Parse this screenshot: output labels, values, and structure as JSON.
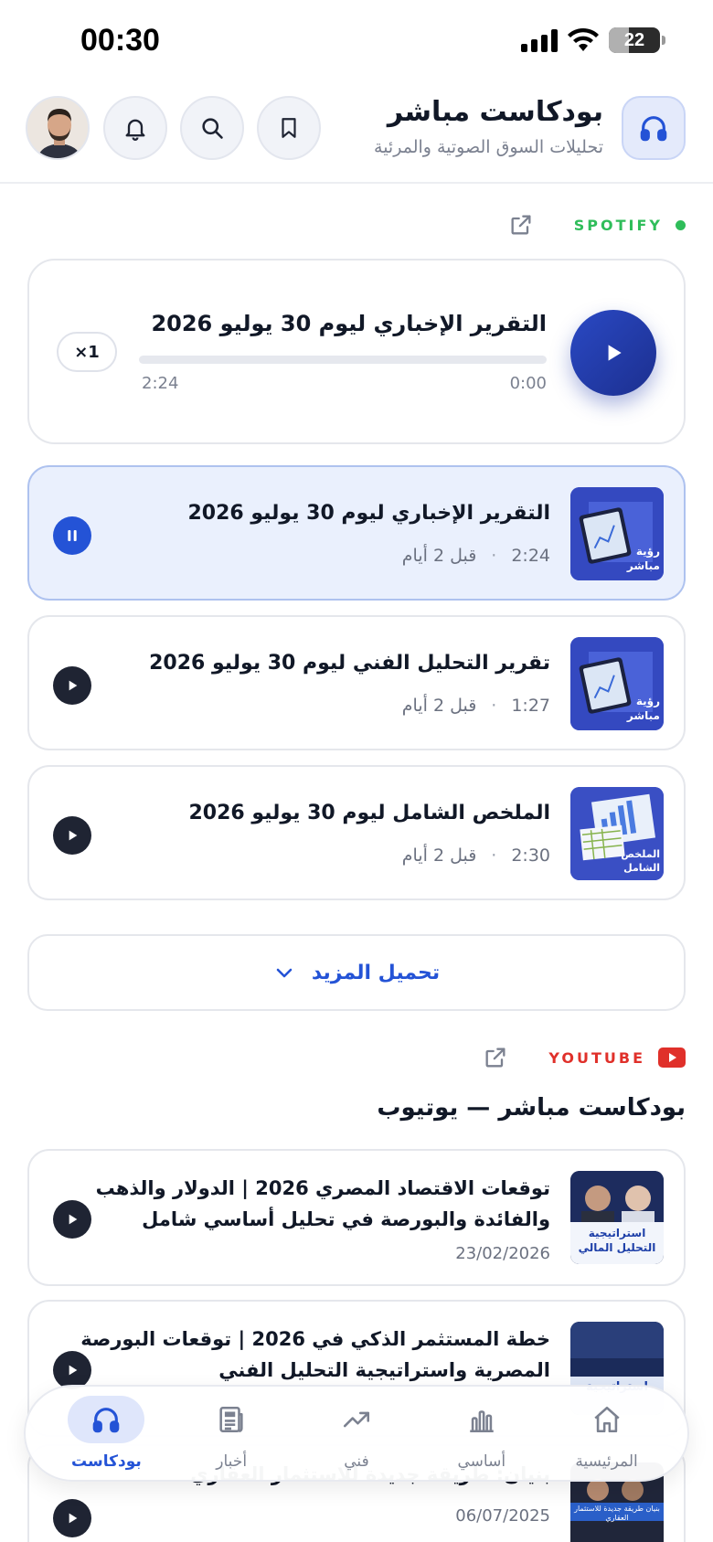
{
  "status_bar": {
    "time": "00:30",
    "battery": "22"
  },
  "header": {
    "title": "بودكاست مباشر",
    "subtitle": "تحليلات السوق الصوتية والمرئية"
  },
  "spotify": {
    "label": "SPOTIFY",
    "accent": "#2fbd5a"
  },
  "player": {
    "title": "التقرير الإخباري ليوم 30 يوليو 2026",
    "current_time": "0:00",
    "duration": "2:24",
    "progress": 0,
    "speed": "×1"
  },
  "episodes": [
    {
      "title": "التقرير الإخباري ليوم 30 يوليو 2026",
      "ago": "قبل 2 أيام",
      "duration": "2:24",
      "thumb_text": "رؤية مباشر",
      "state": "playing"
    },
    {
      "title": "تقرير التحليل الفني ليوم 30 يوليو 2026",
      "ago": "قبل 2 أيام",
      "duration": "1:27",
      "thumb_text": "رؤية مباشر",
      "state": "idle"
    },
    {
      "title": "الملخص الشامل ليوم 30 يوليو 2026",
      "ago": "قبل 2 أيام",
      "duration": "2:30",
      "thumb_text": "الملخص الشامل",
      "state": "idle"
    }
  ],
  "load_more": {
    "label": "تحميل المزيد"
  },
  "youtube": {
    "label": "YOUTUBE",
    "accent": "#e0302a",
    "section_title": "بودكاست مباشر — يوتيوب",
    "videos": [
      {
        "title": "توقعات الاقتصاد المصري 2026 | الدولار والذهب والفائدة والبورصة في تحليل أساسي شامل",
        "date": "23/02/2026",
        "thumb_text": "استراتيجية التحليل المالي"
      },
      {
        "title": "خطة المستثمر الذكي في 2026 | توقعات البورصة المصرية واستراتيجية التحليل الفني",
        "date": "",
        "thumb_text": "استراتيجية"
      },
      {
        "title": "بنيان: طريقة جديدة للاستثمار العقاري",
        "date": "06/07/2025",
        "thumb_text": "بنيان طريقة جديدة للاستثمار العقاري"
      }
    ]
  },
  "nav": {
    "items": [
      {
        "label": "المرئيسية",
        "icon": "home-icon"
      },
      {
        "label": "أساسي",
        "icon": "bar-chart-icon"
      },
      {
        "label": "فني",
        "icon": "trend-icon"
      },
      {
        "label": "أخبار",
        "icon": "news-icon"
      },
      {
        "label": "بودكاست",
        "icon": "headphones-icon"
      }
    ],
    "active": "بودكاست"
  },
  "colors": {
    "primary": "#2453d6",
    "player_gradient_dark": "#1c2f8f"
  }
}
